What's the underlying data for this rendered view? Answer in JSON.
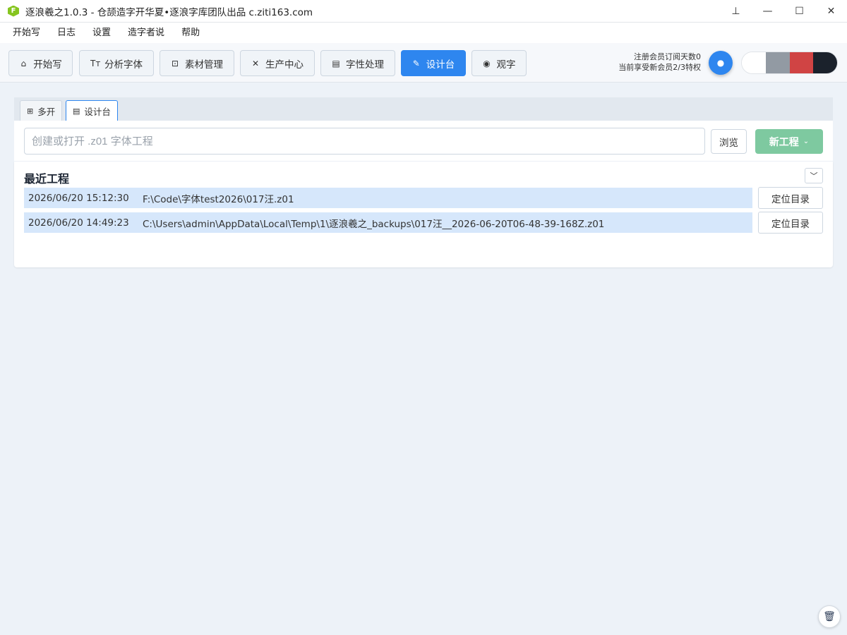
{
  "window": {
    "title": "逐浪羲之1.0.3 - 仓颉造字开华夏•逐浪字库团队出品 c.ziti163.com",
    "app_icon_letter": "F",
    "controls": {
      "pin": "⊥",
      "minimize": "—",
      "maximize": "☐",
      "close": "✕"
    }
  },
  "menu": [
    "开始写",
    "日志",
    "设置",
    "造字者说",
    "帮助"
  ],
  "toolbar": {
    "buttons": [
      {
        "label": "开始写",
        "icon": "home-icon",
        "glyph": "⌂"
      },
      {
        "label": "分析字体",
        "icon": "text-icon",
        "glyph": "Tт"
      },
      {
        "label": "素材管理",
        "icon": "clipboard-icon",
        "glyph": "⊡"
      },
      {
        "label": "生产中心",
        "icon": "tools-icon",
        "glyph": "✕"
      },
      {
        "label": "字性处理",
        "icon": "document-icon",
        "glyph": "▤"
      },
      {
        "label": "设计台",
        "icon": "design-icon",
        "glyph": "✎"
      },
      {
        "label": "观字",
        "icon": "eye-icon",
        "glyph": "◉"
      }
    ],
    "active": "设计台",
    "member_line1": "注册会员订阅天数0",
    "member_line2": "当前享受新会员2/3特权",
    "circle_glyph": "●",
    "theme_swatches": [
      "#ffffff",
      "#929aa3",
      "#d04444",
      "#1b222c"
    ]
  },
  "tabs": [
    {
      "label": "多开",
      "icon": "new-window-icon",
      "glyph": "⊞"
    },
    {
      "label": "设计台",
      "icon": "file-icon",
      "glyph": "▤"
    }
  ],
  "open_project": {
    "placeholder": "创建或打开 .z01 字体工程",
    "browse_label": "浏览",
    "new_label": "新工程",
    "new_chevron": "⌄"
  },
  "recent": {
    "title": "最近工程",
    "collapse_glyph": "﹀",
    "locate_label": "定位目录",
    "items": [
      {
        "date": "2026/06/20 15:12:30",
        "path": "F:\\Code\\字体test2026\\017汪.z01"
      },
      {
        "date": "2026/06/20 14:49:23",
        "path": "C:\\Users\\admin\\AppData\\Local\\Temp\\1\\逐浪羲之_backups\\017汪__2026-06-20T06-48-39-168Z.z01"
      }
    ]
  },
  "trash_glyph": "🗑",
  "colors": {
    "accent": "#2e86ef",
    "new_button": "#7ec9a0",
    "row_highlight": "#d6e7fb"
  }
}
